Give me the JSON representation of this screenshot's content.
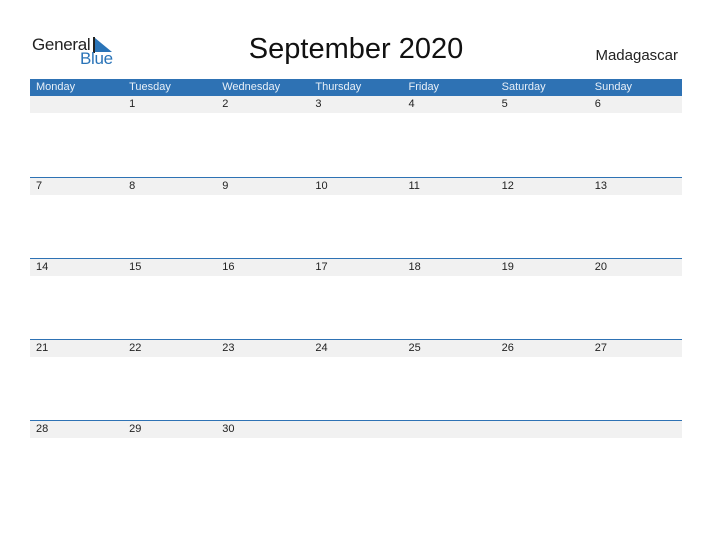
{
  "logo": {
    "general": "General",
    "blue": "Blue"
  },
  "title": "September 2020",
  "country": "Madagascar",
  "colors": {
    "accent": "#2e72b4",
    "date_strip": "#f1f1f1"
  },
  "weekdays": [
    "Monday",
    "Tuesday",
    "Wednesday",
    "Thursday",
    "Friday",
    "Saturday",
    "Sunday"
  ],
  "weeks": [
    [
      "",
      "1",
      "2",
      "3",
      "4",
      "5",
      "6"
    ],
    [
      "7",
      "8",
      "9",
      "10",
      "11",
      "12",
      "13"
    ],
    [
      "14",
      "15",
      "16",
      "17",
      "18",
      "19",
      "20"
    ],
    [
      "21",
      "22",
      "23",
      "24",
      "25",
      "26",
      "27"
    ],
    [
      "28",
      "29",
      "30",
      "",
      "",
      "",
      ""
    ]
  ]
}
